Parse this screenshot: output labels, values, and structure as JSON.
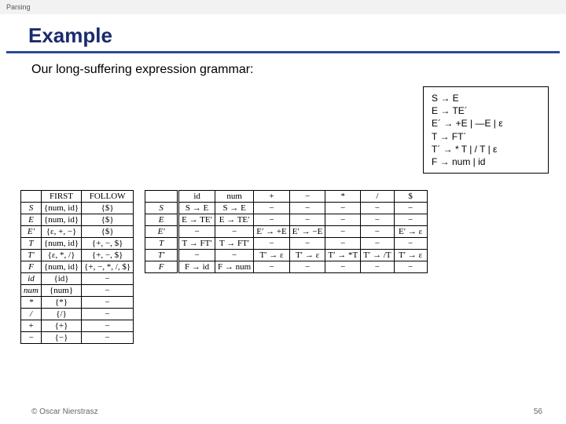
{
  "header": {
    "category": "Parsing"
  },
  "title": "Example",
  "subtitle": "Our long-suffering expression grammar:",
  "grammar": {
    "r1": "S → E",
    "r2": "E → TE´",
    "r3": "E´ → +E | —E | ε",
    "r4": "T → FT´",
    "r5": "T´ → * T | / T | ε",
    "r6": "F → num | id"
  },
  "ff": {
    "h1": "FIRST",
    "h2": "FOLLOW",
    "rows": [
      {
        "nt": "S",
        "first": "{num, id}",
        "follow": "{$}"
      },
      {
        "nt": "E",
        "first": "{num, id}",
        "follow": "{$}"
      },
      {
        "nt": "E′",
        "first": "{ε, +, −}",
        "follow": "{$}"
      },
      {
        "nt": "T",
        "first": "{num, id}",
        "follow": "{+, −, $}"
      },
      {
        "nt": "T′",
        "first": "{ε, *, /}",
        "follow": "{+, −, $}"
      },
      {
        "nt": "F",
        "first": "{num, id}",
        "follow": "{+, −, *, /, $}"
      },
      {
        "nt": "id",
        "first": "{id}",
        "follow": "−"
      },
      {
        "nt": "num",
        "first": "{num}",
        "follow": "−"
      },
      {
        "nt": "*",
        "first": "{*}",
        "follow": "−"
      },
      {
        "nt": "/",
        "first": "{/}",
        "follow": "−"
      },
      {
        "nt": "+",
        "first": "{+}",
        "follow": "−"
      },
      {
        "nt": "−",
        "first": "{−}",
        "follow": "−"
      }
    ]
  },
  "parse": {
    "cols": [
      "id",
      "num",
      "+",
      "−",
      "*",
      "/",
      "$"
    ],
    "rows": [
      {
        "nt": "S",
        "c": [
          "S → E",
          "S → E",
          "−",
          "−",
          "−",
          "−",
          "−"
        ]
      },
      {
        "nt": "E",
        "c": [
          "E → TE′",
          "E → TE′",
          "−",
          "−",
          "−",
          "−",
          "−"
        ]
      },
      {
        "nt": "E′",
        "c": [
          "−",
          "−",
          "E′ → +E",
          "E′ → −E",
          "−",
          "−",
          "E′ → ε"
        ]
      },
      {
        "nt": "T",
        "c": [
          "T → FT′",
          "T → FT′",
          "−",
          "−",
          "−",
          "−",
          "−"
        ]
      },
      {
        "nt": "T′",
        "c": [
          "−",
          "−",
          "T′ → ε",
          "T′ → ε",
          "T′ → *T",
          "T′ → /T",
          "T′ → ε"
        ]
      },
      {
        "nt": "F",
        "c": [
          "F → id",
          "F → num",
          "−",
          "−",
          "−",
          "−",
          "−"
        ]
      }
    ]
  },
  "footer": {
    "copyright": "© Oscar Nierstrasz",
    "page": "56"
  }
}
